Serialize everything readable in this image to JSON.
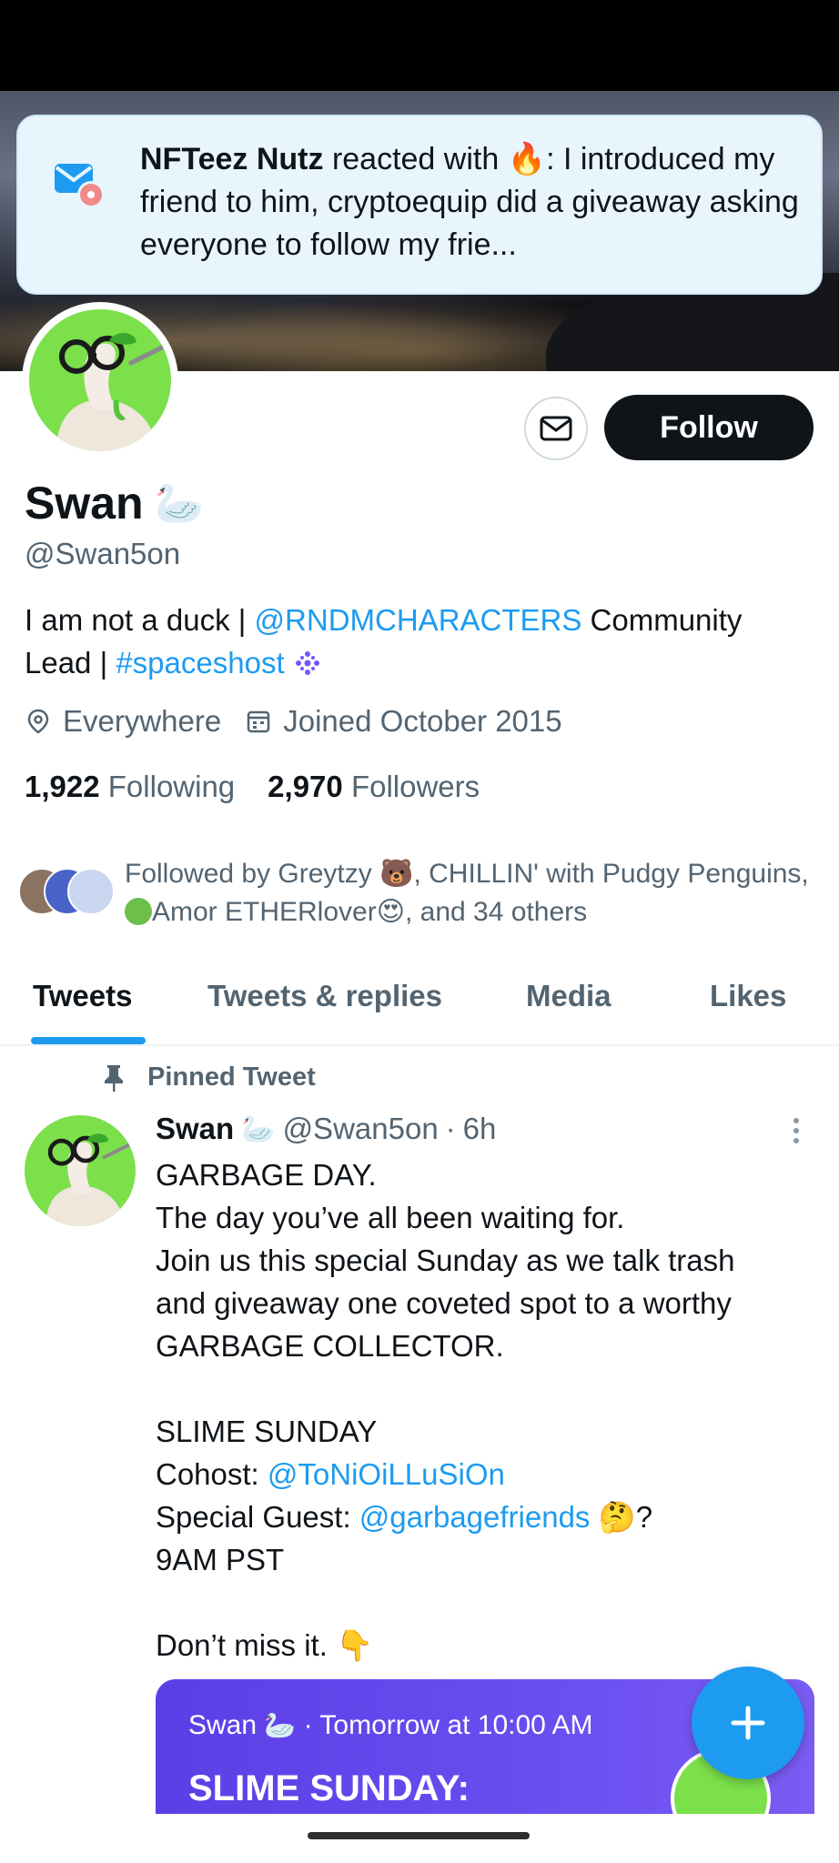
{
  "notification": {
    "actor": "NFTeez Nutz",
    "action": "reacted with",
    "text": ": I introduced my friend to him, cryptoequip did a giveaway asking everyone to follow my frie..."
  },
  "profile": {
    "display_name": "Swan",
    "handle": "@Swan5on",
    "bio_start": "I am not a duck | ",
    "bio_mention": "@RNDMCHARACTERS",
    "bio_mid": " Community Lead | ",
    "bio_hashtag": "#spaceshost",
    "location": "Everywhere",
    "joined": "Joined October 2015",
    "following_count": "1,922",
    "following_label": "Following",
    "followers_count": "2,970",
    "followers_label": "Followers",
    "followed_by": {
      "prefix": "Followed by Greytzy",
      "second": ", CHILLIN' with Pudgy Penguins, ",
      "third": "Amor ETHERlover",
      "suffix": ", and 34 others"
    },
    "follow_button": "Follow"
  },
  "tabs": [
    "Tweets",
    "Tweets & replies",
    "Media",
    "Likes"
  ],
  "active_tab": "Tweets",
  "pinned_label": "Pinned Tweet",
  "tweet": {
    "name": "Swan",
    "handle": "@Swan5on",
    "sep": "·",
    "time": "6h",
    "lines": {
      "l1": "GARBAGE DAY.",
      "l2": "The day you’ve all been waiting for.",
      "l3": "Join us this special Sunday as we talk trash",
      "l4": "and giveaway one coveted spot to a worthy",
      "l5": "GARBAGE COLLECTOR.",
      "l6": "SLIME SUNDAY",
      "l7_label": "Cohost: ",
      "l7_mention": "@ToNiOiLLuSiOn",
      "l8_label": "Special Guest: ",
      "l8_mention": "@garbagefriends",
      "l8_end": "?",
      "l9": "9AM PST",
      "l10": "Don’t miss it."
    },
    "card": {
      "host": "Swan",
      "when": "· Tomorrow at 10:00 AM",
      "title": "SLIME SUNDAY:"
    }
  },
  "colors": {
    "accent": "#1d9bf0",
    "text": "#0f1419",
    "secondary": "#536471",
    "space_card": "#5b3fe6"
  }
}
